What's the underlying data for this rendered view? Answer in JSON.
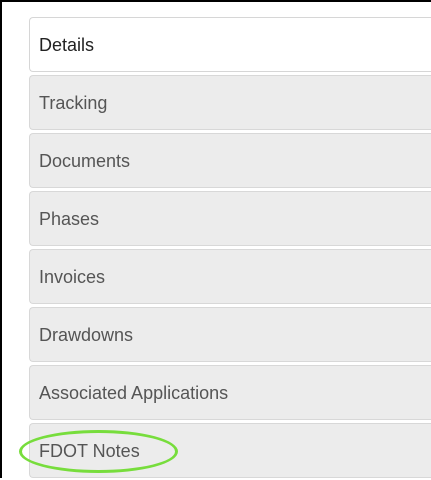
{
  "tabs": [
    {
      "label": "Details",
      "active": true
    },
    {
      "label": "Tracking",
      "active": false
    },
    {
      "label": "Documents",
      "active": false
    },
    {
      "label": "Phases",
      "active": false
    },
    {
      "label": "Invoices",
      "active": false
    },
    {
      "label": "Drawdowns",
      "active": false
    },
    {
      "label": "Associated Applications",
      "active": false
    },
    {
      "label": "FDOT Notes",
      "active": false
    }
  ],
  "colors": {
    "active_tab": "#ffffff",
    "inactive_tab": "#ececec",
    "highlight_ring": "#77dd3c"
  }
}
